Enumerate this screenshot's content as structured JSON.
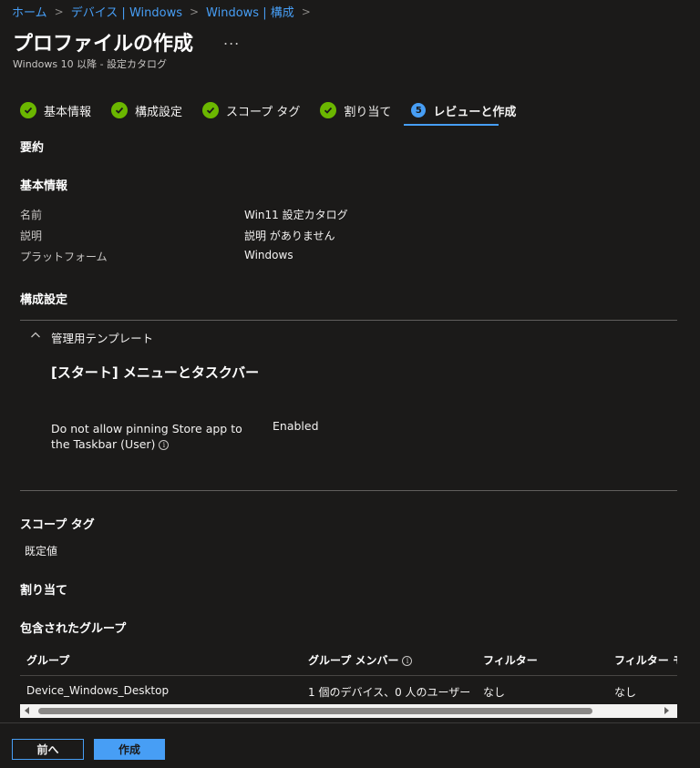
{
  "breadcrumb": [
    "ホーム",
    "デバイス | Windows",
    "Windows | 構成"
  ],
  "header": {
    "title": "プロファイルの作成",
    "more": "...",
    "subtitle": "Windows 10 以降 - 設定カタログ"
  },
  "steps": [
    {
      "label": "基本情報",
      "state": "done"
    },
    {
      "label": "構成設定",
      "state": "done"
    },
    {
      "label": "スコープ タグ",
      "state": "done"
    },
    {
      "label": "割り当て",
      "state": "done"
    },
    {
      "label": "レビューと作成",
      "state": "active",
      "number": "5"
    }
  ],
  "summary_heading": "要約",
  "basics": {
    "heading": "基本情報",
    "rows": [
      {
        "label": "名前",
        "value": "Win11 設定カタログ"
      },
      {
        "label": "説明",
        "value": "説明 がありません"
      },
      {
        "label": "プラットフォーム",
        "value": "Windows"
      }
    ]
  },
  "config": {
    "heading": "構成設定",
    "group": "管理用テンプレート",
    "category": "[スタート] メニューとタスクバー",
    "setting_name": "Do not allow pinning Store app to the Taskbar (User)",
    "setting_value": "Enabled"
  },
  "scope": {
    "heading": "スコープ タグ",
    "value": "既定値"
  },
  "assignments": {
    "heading": "割り当て",
    "included_heading": "包含されたグループ",
    "columns": [
      "グループ",
      "グループ メンバー",
      "フィルター",
      "フィルター モー"
    ],
    "rows": [
      [
        "Device_Windows_Desktop",
        "1 個のデバイス、0 人のユーザー",
        "なし",
        "なし"
      ]
    ]
  },
  "footer": {
    "prev": "前へ",
    "create": "作成"
  },
  "colors": {
    "background": "#1b1a19",
    "accent": "#479ef5",
    "success": "#6bb700"
  }
}
